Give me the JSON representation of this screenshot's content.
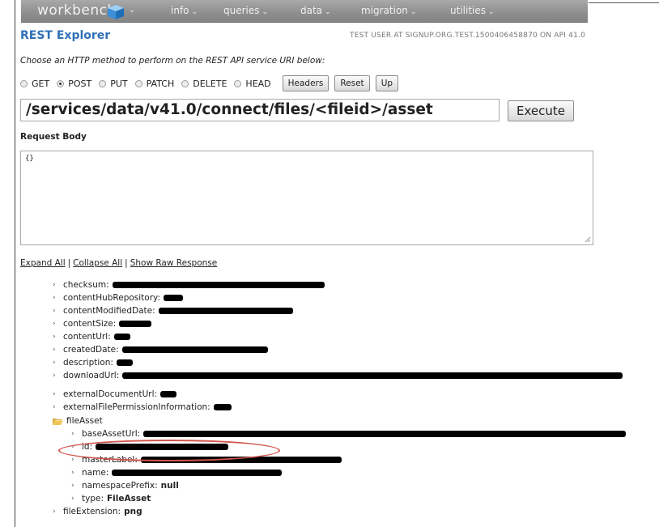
{
  "nav": {
    "brand": "workbench",
    "items": [
      "info",
      "queries",
      "data",
      "migration",
      "utilities"
    ]
  },
  "header": {
    "title": "REST Explorer",
    "user_info": "TEST USER AT SIGNUP.ORG.TEST.1500406458870 ON API 41.0"
  },
  "instructions": "Choose an HTTP method to perform on the REST API service URI below:",
  "methods": [
    {
      "label": "GET",
      "checked": false
    },
    {
      "label": "POST",
      "checked": true
    },
    {
      "label": "PUT",
      "checked": false
    },
    {
      "label": "PATCH",
      "checked": false
    },
    {
      "label": "DELETE",
      "checked": false
    },
    {
      "label": "HEAD",
      "checked": false
    }
  ],
  "buttons": {
    "headers": "Headers",
    "reset": "Reset",
    "up": "Up",
    "execute": "Execute"
  },
  "uri": "/services/data/v41.0/connect/files/<fileid>/asset",
  "request_body": {
    "label": "Request Body",
    "value": "{}"
  },
  "links": {
    "expand": "Expand All",
    "collapse": "Collapse All",
    "raw": "Show Raw Response"
  },
  "tree": {
    "checksum": "checksum:",
    "contentHubRepository": "contentHubRepository:",
    "contentModifiedDate": "contentModifiedDate:",
    "contentSize": "contentSize:",
    "contentUrl": "contentUrl:",
    "createdDate": "createdDate:",
    "description": "description:",
    "downloadUrl": "downloadUrl:",
    "externalDocumentUrl": "externalDocumentUrl:",
    "externalFilePermissionInformation": "externalFilePermissionInformation:",
    "fileAsset": "fileAsset",
    "baseAssetUrl": "baseAssetUrl:",
    "id": "id:",
    "masterLabel": "masterLabel:",
    "name": "name:",
    "namespacePrefix": "namespacePrefix:",
    "namespacePrefix_value": "null",
    "type": "type:",
    "type_value": "FileAsset",
    "fileExtension": "fileExtension:",
    "fileExtension_value": "png"
  },
  "colors": {
    "accent": "#2f71b8",
    "highlight": "#d2544b",
    "navbar": "#8e8e8e"
  }
}
